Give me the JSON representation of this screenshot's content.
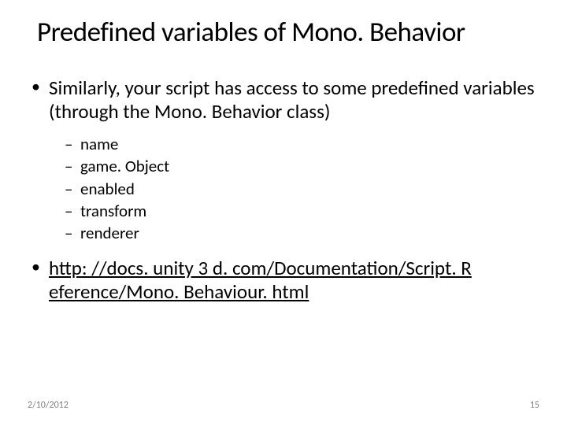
{
  "title": "Predefined variables of Mono. Behavior",
  "bullets": {
    "intro": "Similarly, your script has access to some predefined variables (through the Mono. Behavior class)",
    "sub": [
      "name",
      "game. Object",
      "enabled",
      "transform",
      "renderer"
    ],
    "link": "http: //docs. unity 3 d. com/Documentation/Script. R eference/Mono. Behaviour. html"
  },
  "footer": {
    "date": "2/10/2012",
    "page": "15"
  }
}
